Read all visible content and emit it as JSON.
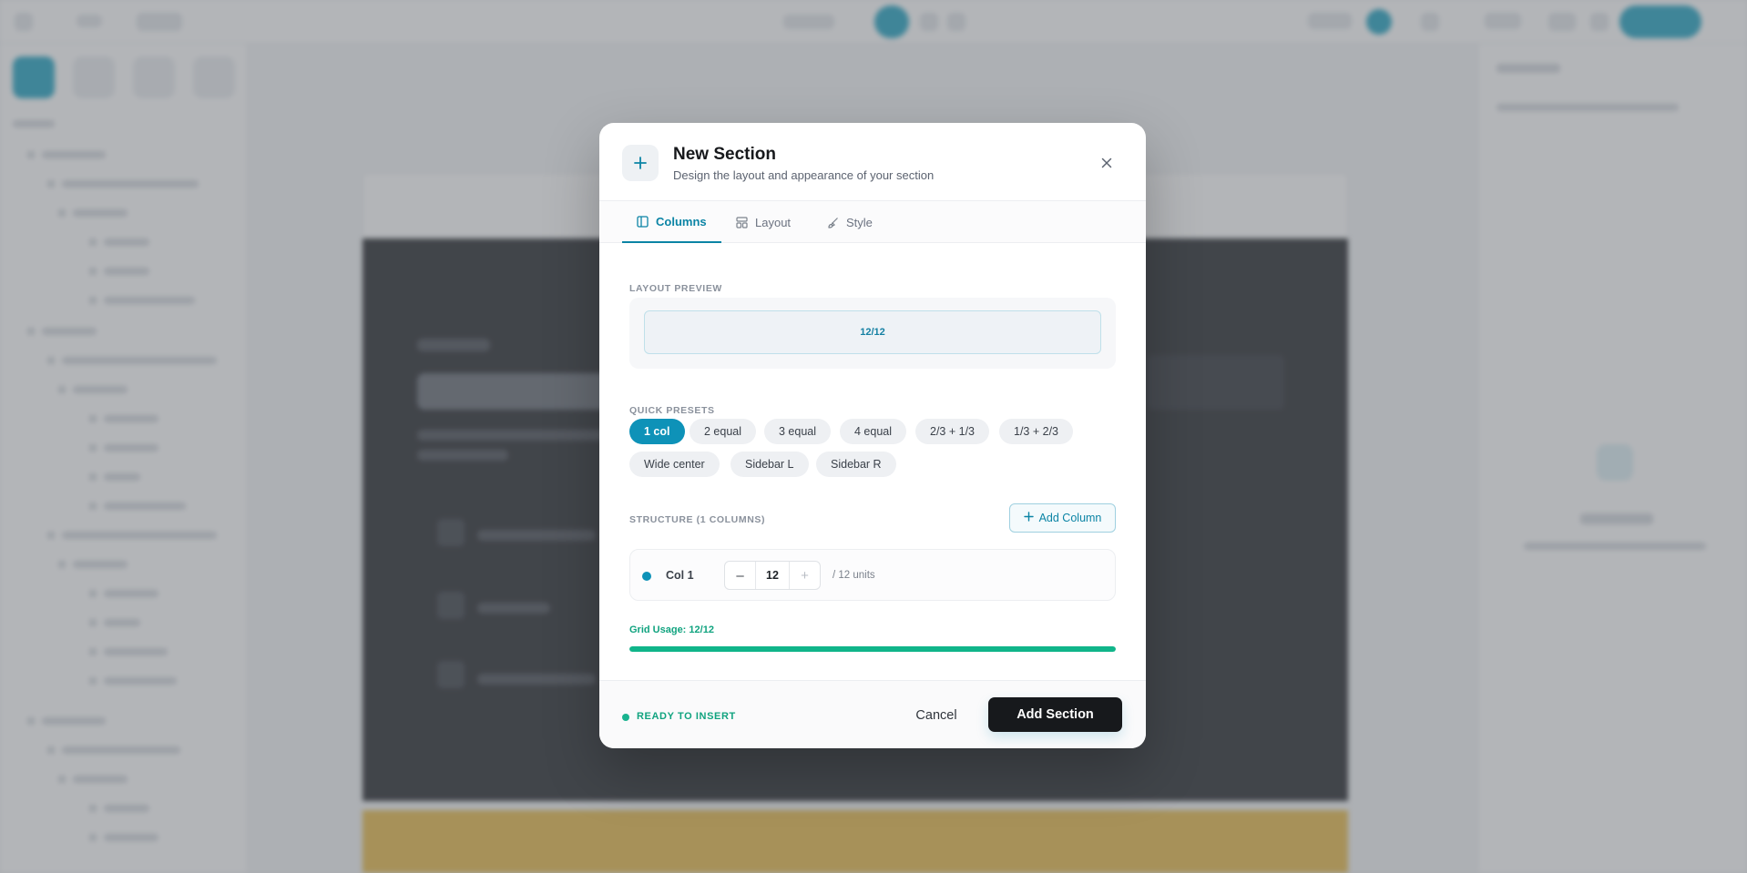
{
  "modal": {
    "title": "New Section",
    "subtitle": "Design the layout and appearance of your section",
    "header_icon": "plus-icon",
    "close_icon": "close-icon"
  },
  "tabs": [
    {
      "label": "Columns",
      "icon": "columns-icon",
      "active": true
    },
    {
      "label": "Layout",
      "icon": "layout-icon",
      "active": false
    },
    {
      "label": "Style",
      "icon": "brush-icon",
      "active": false
    }
  ],
  "preview": {
    "label": "LAYOUT PREVIEW",
    "columns": [
      "12/12"
    ]
  },
  "presets": {
    "label": "QUICK PRESETS",
    "items": [
      {
        "label": "1 col",
        "active": true
      },
      {
        "label": "2 equal",
        "active": false
      },
      {
        "label": "3 equal",
        "active": false
      },
      {
        "label": "4 equal",
        "active": false
      },
      {
        "label": "2/3 + 1/3",
        "active": false
      },
      {
        "label": "1/3 + 2/3",
        "active": false
      },
      {
        "label": "Wide center",
        "active": false
      },
      {
        "label": "Sidebar L",
        "active": false
      },
      {
        "label": "Sidebar R",
        "active": false
      }
    ]
  },
  "structure": {
    "label": "STRUCTURE (1 COLUMNS)",
    "add_column_label": "Add Column",
    "columns": [
      {
        "name": "Col 1",
        "value": "12",
        "units": "/ 12 units"
      }
    ]
  },
  "grid_usage": {
    "label": "Grid Usage: 12/12",
    "fraction": 1.0
  },
  "footer": {
    "status": "READY TO INSERT",
    "cancel_label": "Cancel",
    "submit_label": "Add Section"
  },
  "colors": {
    "accent": "#0e92b8",
    "success": "#10b58a",
    "primary_button": "#17191c"
  }
}
